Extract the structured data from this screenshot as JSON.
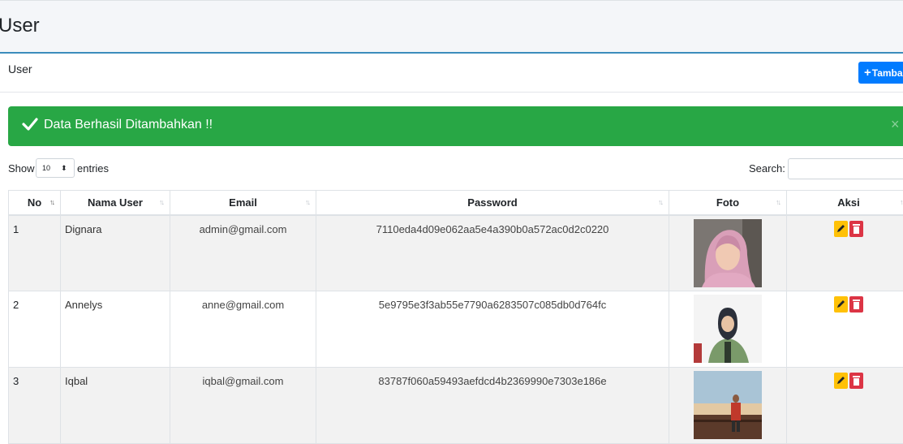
{
  "header": {
    "title": "User"
  },
  "card": {
    "title": "User",
    "add_button_label": "Tamba"
  },
  "alert": {
    "message": "Data Berhasil Ditambahkan !!",
    "close_glyph": "×"
  },
  "table_controls": {
    "show_label": "Show",
    "entries_value": "10",
    "entries_label": "entries",
    "search_label": "Search:"
  },
  "table": {
    "columns": [
      "No",
      "Nama User",
      "Email",
      "Password",
      "Foto",
      "Aksi"
    ],
    "rows": [
      {
        "no": "1",
        "name": "Dignara",
        "email": "admin@gmail.com",
        "password": "7110eda4d09e062aa5e4a390b0a572ac0d2c0220"
      },
      {
        "no": "2",
        "name": "Annelys",
        "email": "anne@gmail.com",
        "password": "5e9795e3f3ab55e7790a6283507c085db0d764fc"
      },
      {
        "no": "3",
        "name": "Iqbal",
        "email": "iqbal@gmail.com",
        "password": "83787f060a59493aefdcd4b2369990e7303e186e"
      }
    ]
  },
  "colors": {
    "primary": "#007bff",
    "success": "#28a745",
    "warning": "#ffc107",
    "danger": "#dc3545"
  },
  "icons": {
    "alert": "check-icon",
    "add": "plus-icon",
    "edit": "pencil-icon",
    "delete": "trash-icon",
    "sort": "sort-icon"
  }
}
